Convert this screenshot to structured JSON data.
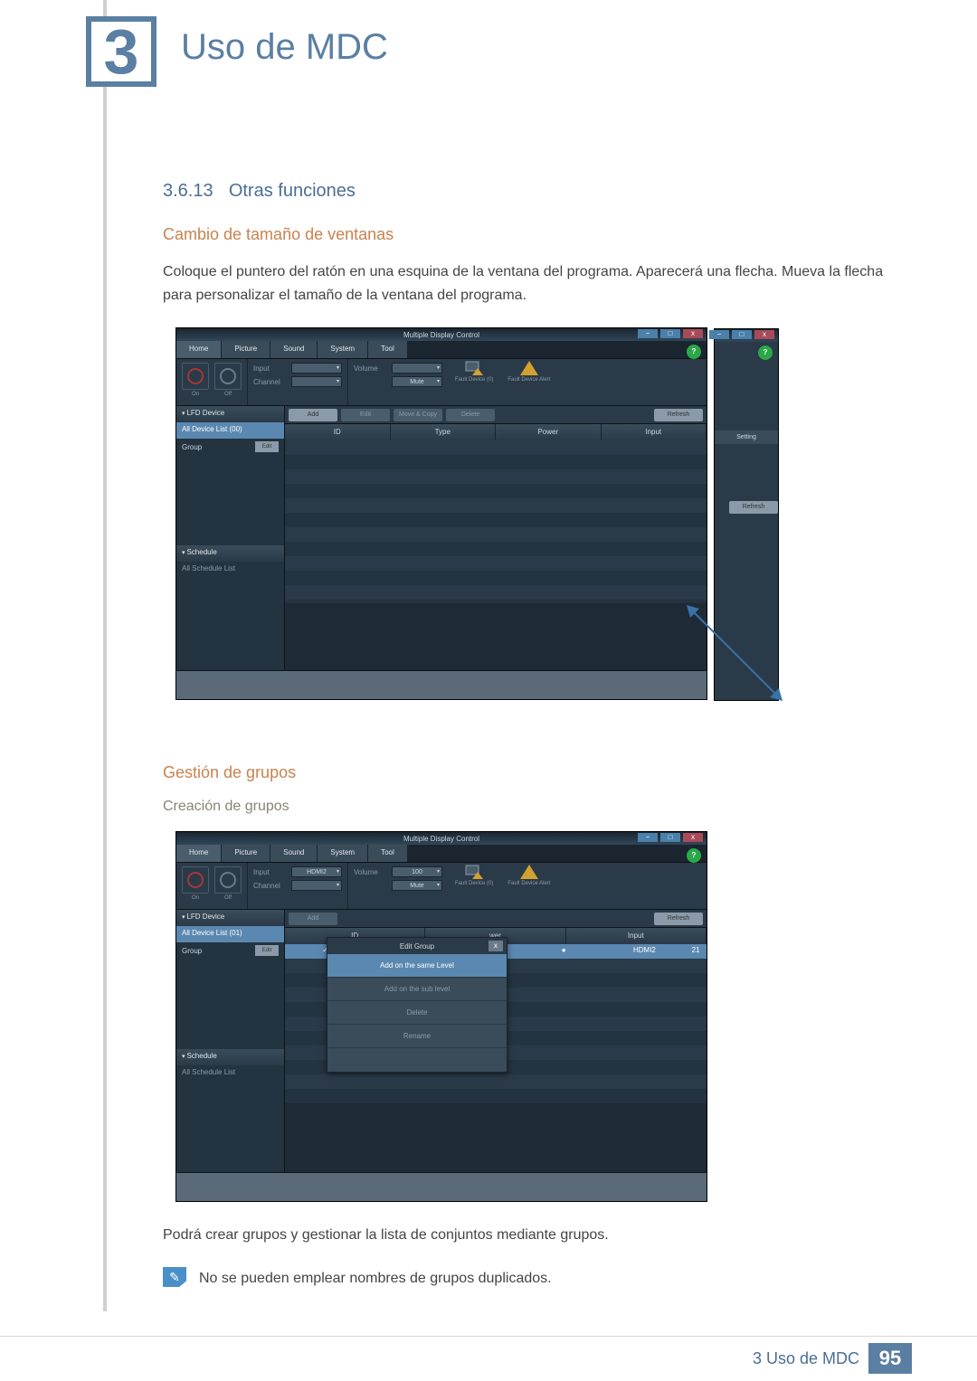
{
  "chapter": {
    "num": "3",
    "title": "Uso de MDC"
  },
  "section": {
    "num": "3.6.13",
    "title": "Otras funciones"
  },
  "sub1": {
    "title": "Cambio de tamaño de ventanas",
    "body": "Coloque el puntero del ratón en una esquina de la ventana del programa. Aparecerá una flecha. Mueva la flecha para personalizar el tamaño de la ventana del programa."
  },
  "sub2": {
    "title": "Gestión de grupos",
    "sub_title": "Creación de grupos",
    "body": "Podrá crear grupos y gestionar la lista de conjuntos mediante grupos.",
    "note": "No se pueden emplear nombres de grupos duplicados."
  },
  "app": {
    "title": "Multiple Display Control",
    "help": "?",
    "win_min": "−",
    "win_max": "□",
    "win_close": "x",
    "tabs": {
      "home": "Home",
      "picture": "Picture",
      "sound": "Sound",
      "system": "System",
      "tool": "Tool"
    },
    "toolbar": {
      "on": "On",
      "off": "Off",
      "input": "Input",
      "input_val": "HDMI2",
      "channel": "Channel",
      "volume": "Volume",
      "volume_val": "100",
      "mute": "Mute",
      "fault0": "Fault Device (0)",
      "fault_alert": "Fault Device Alert"
    },
    "sidebar": {
      "lfd": "LFD Device",
      "all_devices": "All Device List (01)",
      "all_devices0": "All Device List (00)",
      "group": "Group",
      "edit": "Edit",
      "schedule": "Schedule",
      "all_schedule": "All Schedule List"
    },
    "buttons": {
      "add": "Add",
      "edit": "Edit",
      "move_copy": "Move & Copy",
      "delete": "Delete",
      "refresh": "Refresh"
    },
    "table": {
      "id": "ID",
      "type": "Type",
      "power": "Power",
      "input": "Input",
      "setting": "Setting"
    },
    "data_row": {
      "power": "wer",
      "input_col": "Input",
      "input_val": "HDMI2",
      "num": "21"
    },
    "popup": {
      "title": "Edit Group",
      "close": "x",
      "add_same": "Add on the same Level",
      "add_sub": "Add on the sub level",
      "delete": "Delete",
      "rename": "Rename"
    }
  },
  "footer": {
    "text": "3 Uso de MDC",
    "page": "95"
  }
}
